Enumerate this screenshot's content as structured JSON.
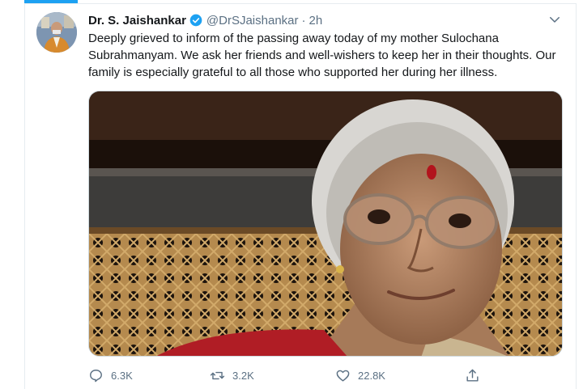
{
  "tweet": {
    "author_name": "Dr. S. Jaishankar",
    "handle": "@DrSJaishankar",
    "separator": "·",
    "time": "2h",
    "text": "Deeply grieved to inform of the passing away today of my mother Sulochana Subrahmanyam. We ask her friends and well-wishers to keep her in their thoughts. Our family is especially grateful to all those who supported her during her illness.",
    "verified": true,
    "photo_description_icon": "portrait-photo"
  },
  "actions": {
    "replies": "6.3K",
    "retweets": "3.2K",
    "likes": "22.8K"
  },
  "colors": {
    "accent": "#1da1f2",
    "muted": "#5b7083",
    "text": "#14171a"
  }
}
